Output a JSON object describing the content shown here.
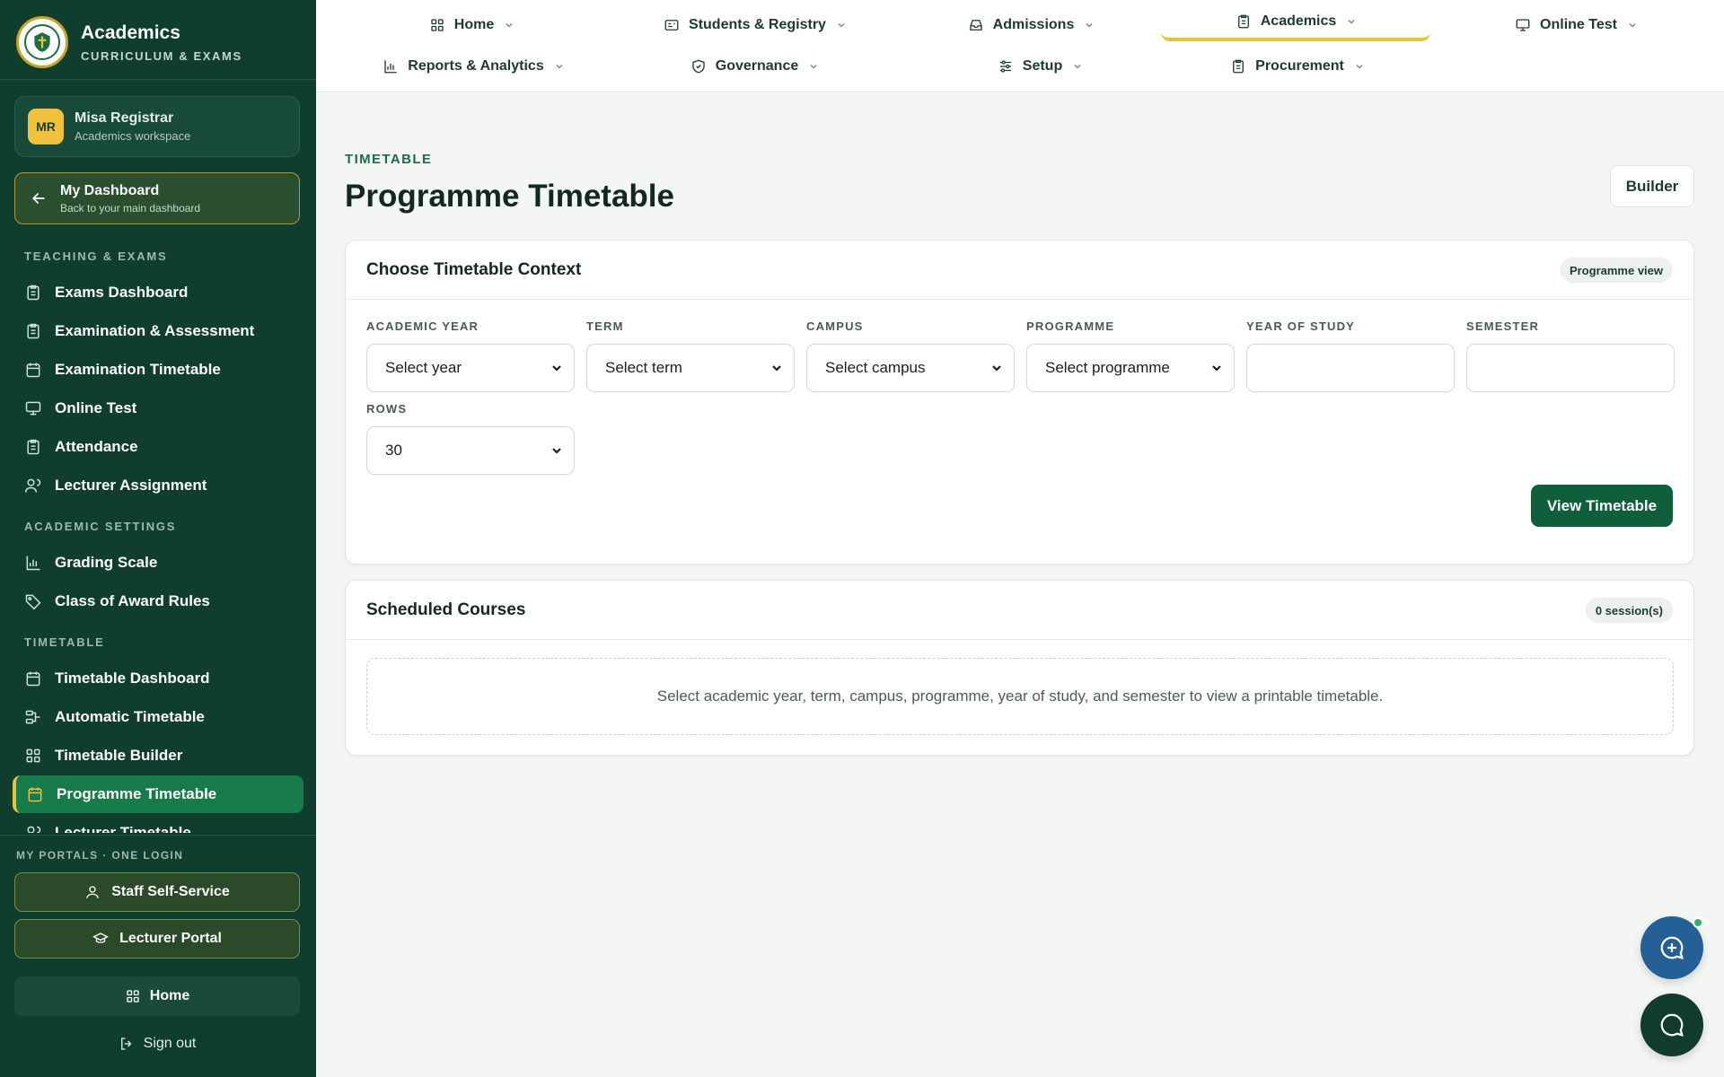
{
  "brand": {
    "title": "Academics",
    "subtitle": "CURRICULUM & EXAMS"
  },
  "user": {
    "initials": "MR",
    "name": "Misa Registrar",
    "role": "Academics workspace"
  },
  "dashboard_link": {
    "title": "My Dashboard",
    "subtitle": "Back to your main dashboard"
  },
  "sidebar": {
    "sections": [
      {
        "title": "TEACHING & EXAMS",
        "items": [
          {
            "label": "Exams Dashboard",
            "icon": "clipboard-icon"
          },
          {
            "label": "Examination & Assessment",
            "icon": "clipboard-icon"
          },
          {
            "label": "Examination Timetable",
            "icon": "calendar-icon"
          },
          {
            "label": "Online Test",
            "icon": "monitor-icon"
          },
          {
            "label": "Attendance",
            "icon": "clipboard-icon"
          },
          {
            "label": "Lecturer Assignment",
            "icon": "users-icon"
          }
        ]
      },
      {
        "title": "ACADEMIC SETTINGS",
        "items": [
          {
            "label": "Grading Scale",
            "icon": "bar-chart-icon"
          },
          {
            "label": "Class of Award Rules",
            "icon": "tag-icon"
          }
        ]
      },
      {
        "title": "TIMETABLE",
        "items": [
          {
            "label": "Timetable Dashboard",
            "icon": "calendar-icon"
          },
          {
            "label": "Automatic Timetable",
            "icon": "workflow-icon"
          },
          {
            "label": "Timetable Builder",
            "icon": "grid-icon"
          },
          {
            "label": "Programme Timetable",
            "icon": "calendar-icon",
            "active": true
          },
          {
            "label": "Lecturer Timetable",
            "icon": "users-icon"
          }
        ]
      }
    ]
  },
  "portals": {
    "title": "MY PORTALS · ONE LOGIN",
    "staff": "Staff Self-Service",
    "lecturer": "Lecturer Portal",
    "home": "Home",
    "signout": "Sign out"
  },
  "topnav": {
    "row1": [
      {
        "label": "Home",
        "icon": "grid-icon"
      },
      {
        "label": "Students & Registry",
        "icon": "id-card-icon"
      },
      {
        "label": "Admissions",
        "icon": "inbox-icon"
      },
      {
        "label": "Academics",
        "icon": "clipboard-icon",
        "active": true
      },
      {
        "label": "Online Test",
        "icon": "monitor-icon"
      }
    ],
    "row2": [
      {
        "label": "Reports & Analytics",
        "icon": "bar-chart-icon"
      },
      {
        "label": "Governance",
        "icon": "shield-icon"
      },
      {
        "label": "Setup",
        "icon": "sliders-icon"
      },
      {
        "label": "Procurement",
        "icon": "clipboard-icon"
      }
    ]
  },
  "page": {
    "eyebrow": "TIMETABLE",
    "title": "Programme Timetable",
    "builder_label": "Builder"
  },
  "context_card": {
    "title": "Choose Timetable Context",
    "badge": "Programme view",
    "fields": {
      "academic_year": {
        "label": "ACADEMIC YEAR",
        "value": "Select year"
      },
      "term": {
        "label": "TERM",
        "value": "Select term"
      },
      "campus": {
        "label": "CAMPUS",
        "value": "Select campus"
      },
      "programme": {
        "label": "PROGRAMME",
        "value": "Select programme"
      },
      "year_of_study": {
        "label": "YEAR OF STUDY",
        "value": ""
      },
      "semester": {
        "label": "SEMESTER",
        "value": ""
      },
      "rows": {
        "label": "ROWS",
        "value": "30"
      }
    },
    "view_button": "View Timetable"
  },
  "scheduled_card": {
    "title": "Scheduled Courses",
    "badge": "0 session(s)",
    "empty_message": "Select academic year, term, campus, programme, year of study, and semester to view a printable timetable."
  },
  "colors": {
    "sidebar_bg": "#0f3d2e",
    "accent": "#e8c33a",
    "primary": "#0f5e3c",
    "active_item": "#177a4a",
    "assistant_fab": "#245f95",
    "chat_fab": "#103b2d"
  }
}
